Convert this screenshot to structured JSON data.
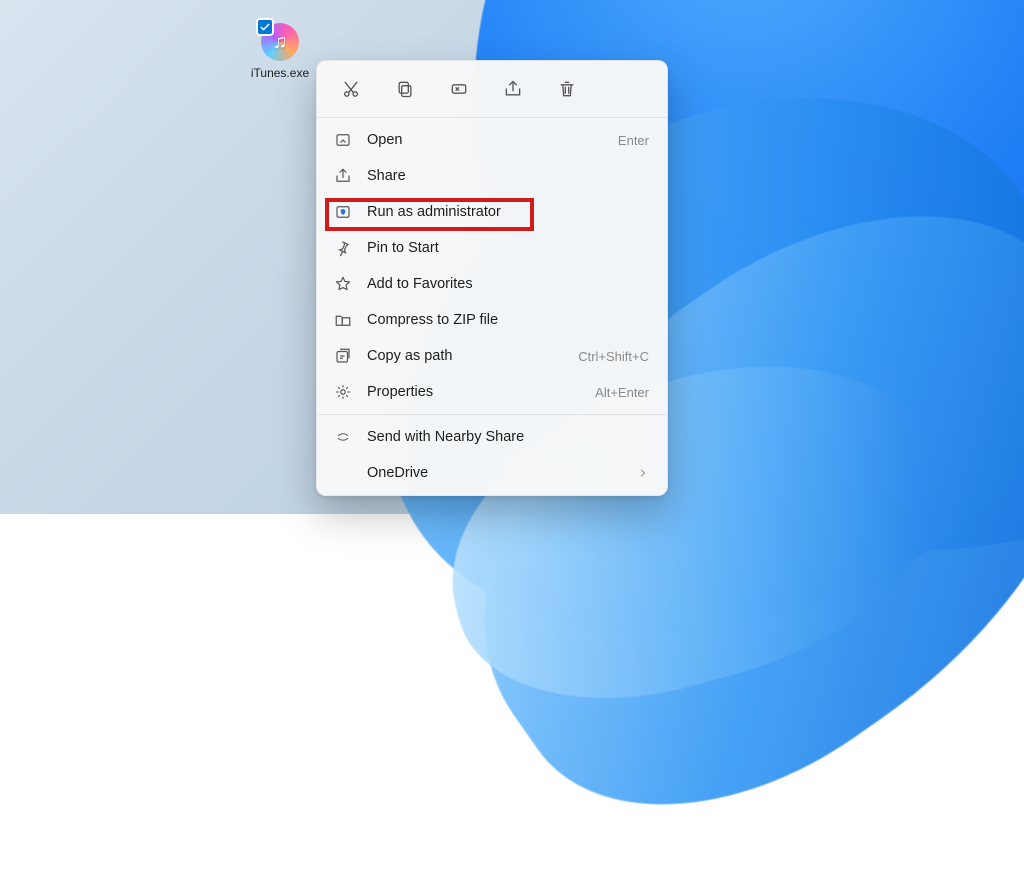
{
  "desktop": {
    "icon": {
      "label": "iTunes.exe"
    }
  },
  "context_menu": {
    "quick_actions": [
      {
        "name": "cut"
      },
      {
        "name": "copy"
      },
      {
        "name": "rename"
      },
      {
        "name": "share"
      },
      {
        "name": "delete"
      }
    ],
    "items": [
      {
        "key": "open",
        "label": "Open",
        "accel": "Enter",
        "has_sub": false
      },
      {
        "key": "share",
        "label": "Share",
        "accel": "",
        "has_sub": false
      },
      {
        "key": "runadmin",
        "label": "Run as administrator",
        "accel": "",
        "has_sub": false,
        "highlighted": true
      },
      {
        "key": "pin",
        "label": "Pin to Start",
        "accel": "",
        "has_sub": false
      },
      {
        "key": "fav",
        "label": "Add to Favorites",
        "accel": "",
        "has_sub": false
      },
      {
        "key": "zip",
        "label": "Compress to ZIP file",
        "accel": "",
        "has_sub": false
      },
      {
        "key": "copypath",
        "label": "Copy as path",
        "accel": "Ctrl+Shift+C",
        "has_sub": false
      },
      {
        "key": "props",
        "label": "Properties",
        "accel": "Alt+Enter",
        "has_sub": false
      }
    ],
    "extra": [
      {
        "key": "nearby",
        "label": "Send with Nearby Share",
        "has_sub": false
      },
      {
        "key": "onedrive",
        "label": "OneDrive",
        "has_sub": true
      }
    ]
  }
}
